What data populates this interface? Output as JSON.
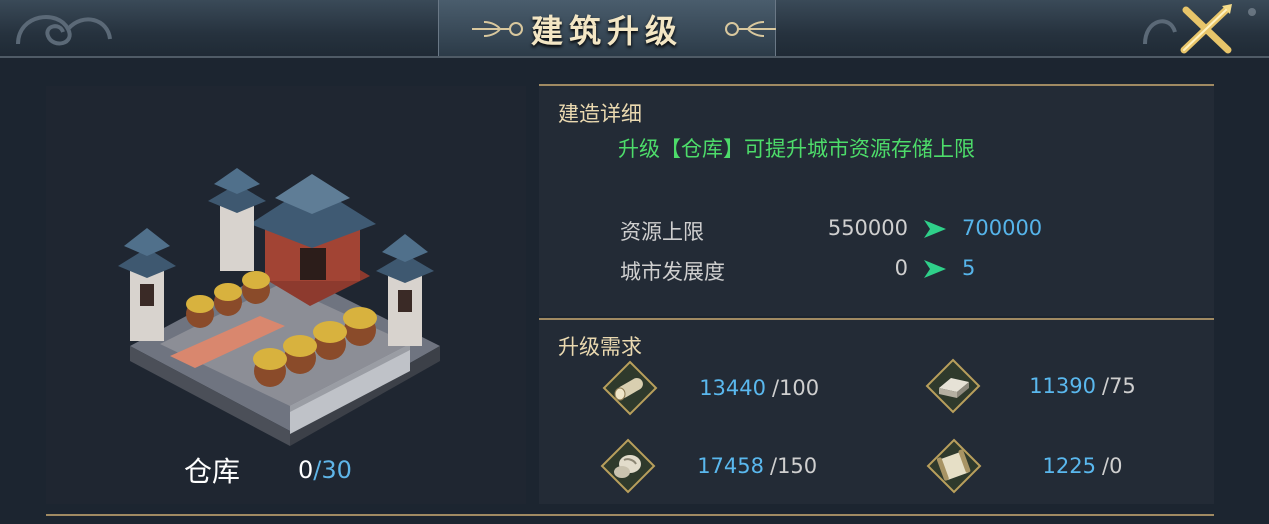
{
  "header": {
    "title": "建筑升级",
    "close_icon": "crossed-swords-close-icon"
  },
  "building": {
    "name": "仓库",
    "level_current": "0",
    "level_max": "/30",
    "image_icon": "warehouse-building-illustration"
  },
  "details": {
    "section_title": "建造详细",
    "description": "升级【仓库】可提升城市资源存储上限",
    "stats": [
      {
        "label": "资源上限",
        "old_value": "550000",
        "new_value": "700000"
      },
      {
        "label": "城市发展度",
        "old_value": "0",
        "new_value": "5"
      }
    ]
  },
  "requirements": {
    "section_title": "升级需求",
    "items": [
      {
        "icon": "wood-log-icon",
        "have": "13440",
        "need": "/100"
      },
      {
        "icon": "iron-ingot-icon",
        "have": "11390",
        "need": "/75"
      },
      {
        "icon": "stone-ore-icon",
        "have": "17458",
        "need": "/150"
      },
      {
        "icon": "scroll-order-icon",
        "have": "1225",
        "need": "/0"
      }
    ]
  },
  "colors": {
    "increase_arrow": "#2fd08a",
    "new_value": "#56b4ea",
    "description": "#4ddc6a",
    "section_title": "#ead9b0",
    "gold_border": "#a08a62"
  }
}
